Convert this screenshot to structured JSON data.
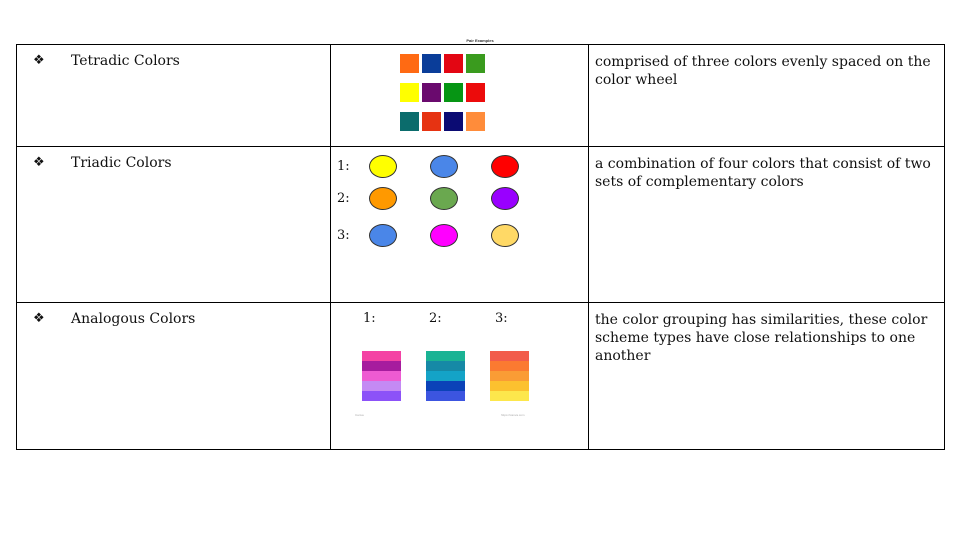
{
  "caption": "Pair Examples",
  "rows": [
    {
      "bullet": "❖",
      "term": "Tetradic Colors",
      "description": "comprised of three colors evenly spaced on the color wheel",
      "swatch_rows": [
        [
          "#ff6a13",
          "#0a3d99",
          "#e30613",
          "#3a9b1e"
        ],
        [
          "#ffff00",
          "#6a0a6e",
          "#069514",
          "#ec0b0b"
        ],
        [
          "#0b6c6c",
          "#e63312",
          "#0b0b73",
          "#ff8c3a"
        ]
      ]
    },
    {
      "bullet": "❖",
      "term": "Triadic Colors",
      "description": "a combination of four colors that consist of two sets of complementary colors",
      "sets": [
        {
          "label": "1:",
          "colors": [
            "#ffff00",
            "#4a86e8",
            "#ff0000"
          ]
        },
        {
          "label": "2:",
          "colors": [
            "#ff9900",
            "#6aa84f",
            "#9900ff"
          ]
        },
        {
          "label": "3:",
          "colors": [
            "#4a86e8",
            "#ff00ff",
            "#ffd966"
          ]
        }
      ]
    },
    {
      "bullet": "❖",
      "term": "Analogous Colors",
      "description": "the color grouping has similarities, these color scheme types have close relationships to one another",
      "labels": [
        "1:",
        "2:",
        "3:"
      ],
      "stacks": [
        [
          "#f442a4",
          "#a61c9e",
          "#ee5bd2",
          "#c48af4",
          "#8c52f8"
        ],
        [
          "#1ab394",
          "#1689a6",
          "#14a3c7",
          "#0b42b8",
          "#3c55e0"
        ],
        [
          "#f25c4b",
          "#fb7a31",
          "#fa9c35",
          "#fcc12f",
          "#fde74c"
        ]
      ],
      "fine_print": [
        "Canva",
        "https://canva.com"
      ]
    }
  ]
}
